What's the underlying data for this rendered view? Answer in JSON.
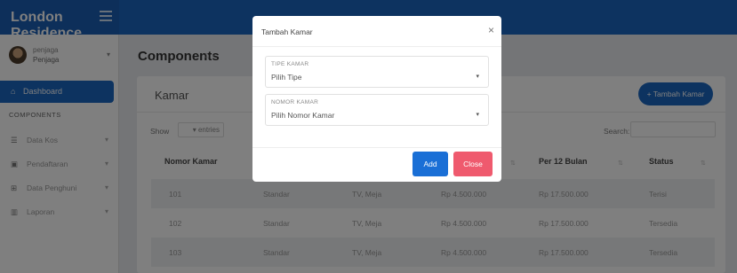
{
  "app": {
    "brand": "London Residence"
  },
  "user": {
    "name": "penjaga",
    "role": "Penjaga"
  },
  "sidebar": {
    "active": {
      "label": "Dashboard",
      "icon": "home-icon"
    },
    "section": "COMPONENTS",
    "items": [
      {
        "label": "Data Kos",
        "icon": "database-icon"
      },
      {
        "label": "Pendaftaran",
        "icon": "form-icon"
      },
      {
        "label": "Data Penghuni",
        "icon": "table-icon"
      },
      {
        "label": "Laporan",
        "icon": "chart-icon"
      }
    ]
  },
  "header": {
    "title": "Components"
  },
  "card": {
    "title": "Kamar",
    "add_button": "+ Tambah Kamar",
    "show_label": "Show",
    "entries_label": "entries",
    "search_label": "Search:"
  },
  "table": {
    "columns": [
      "Nomor Kamar",
      "",
      "",
      "",
      "Per 12 Bulan",
      "Status"
    ],
    "rows": [
      [
        "101",
        "Standar",
        "TV, Meja",
        "Rp 4.500.000",
        "Rp 17.500.000",
        "Terisi"
      ],
      [
        "102",
        "Standar",
        "TV, Meja",
        "Rp 4.500.000",
        "Rp 17.500.000",
        "Tersedia"
      ],
      [
        "103",
        "Standar",
        "TV, Meja",
        "Rp 4.500.000",
        "Rp 17.500.000",
        "Tersedia"
      ]
    ]
  },
  "modal": {
    "title": "Tambah Kamar",
    "close_glyph": "×",
    "fields": [
      {
        "label": "TIPE KAMAR",
        "value": "Pilih Tipe"
      },
      {
        "label": "NOMOR KAMAR",
        "value": "Pilih Nomor Kamar"
      }
    ],
    "add_button": "Add",
    "close_button": "Close"
  },
  "colors": {
    "primary": "#1a66c0",
    "danger": "#ef5a6e"
  }
}
